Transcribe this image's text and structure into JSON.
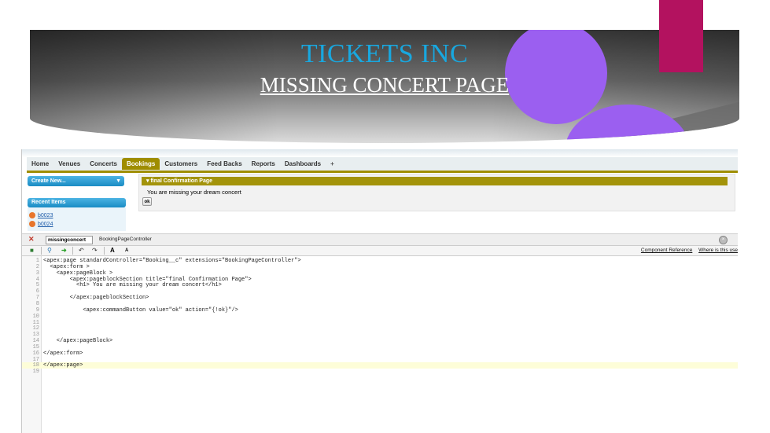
{
  "slide": {
    "title": "TICKETS INC",
    "subtitle": "MISSING CONCERT PAGE",
    "colors": {
      "title": "#18a8e0",
      "accent_purple": "#9b5ff0",
      "accent_magenta": "#b3125f"
    }
  },
  "app": {
    "tabs": [
      "Home",
      "Venues",
      "Concerts",
      "Bookings",
      "Customers",
      "Feed Backs",
      "Reports",
      "Dashboards",
      "+"
    ],
    "active_tab": "Bookings",
    "sidebar": {
      "create_label": "Create New...",
      "recent_heading": "Recent Items",
      "recent_items": [
        "b0023",
        "b0024"
      ]
    },
    "page_block": {
      "section_title": "final Confirmation Page",
      "message": "You are missing your dream concert",
      "button_label": "ok"
    }
  },
  "dev_footer": {
    "page_name": "missingconcert",
    "controller": "BookingPageController",
    "links": [
      "Component Reference",
      "Where is this use"
    ],
    "code_lines": [
      "<apex:page standardController=\"Booking__c\" extensions=\"BookingPageController\">",
      "  <apex:form >",
      "    <apex:pageBlock >",
      "        <apex:pageblockSection title=\"final Confirmation Page\">",
      "          <h1> You are missing your dream concert</h1>",
      "",
      "        </apex:pageblockSection>",
      "",
      "            <apex:commandButton value=\"ok\" action=\"{!ok}\"/>",
      "",
      "",
      "",
      "",
      "    </apex:pageBlock>",
      "",
      "</apex:form>",
      "",
      "</apex:page>",
      ""
    ],
    "highlighted_line": 18
  }
}
